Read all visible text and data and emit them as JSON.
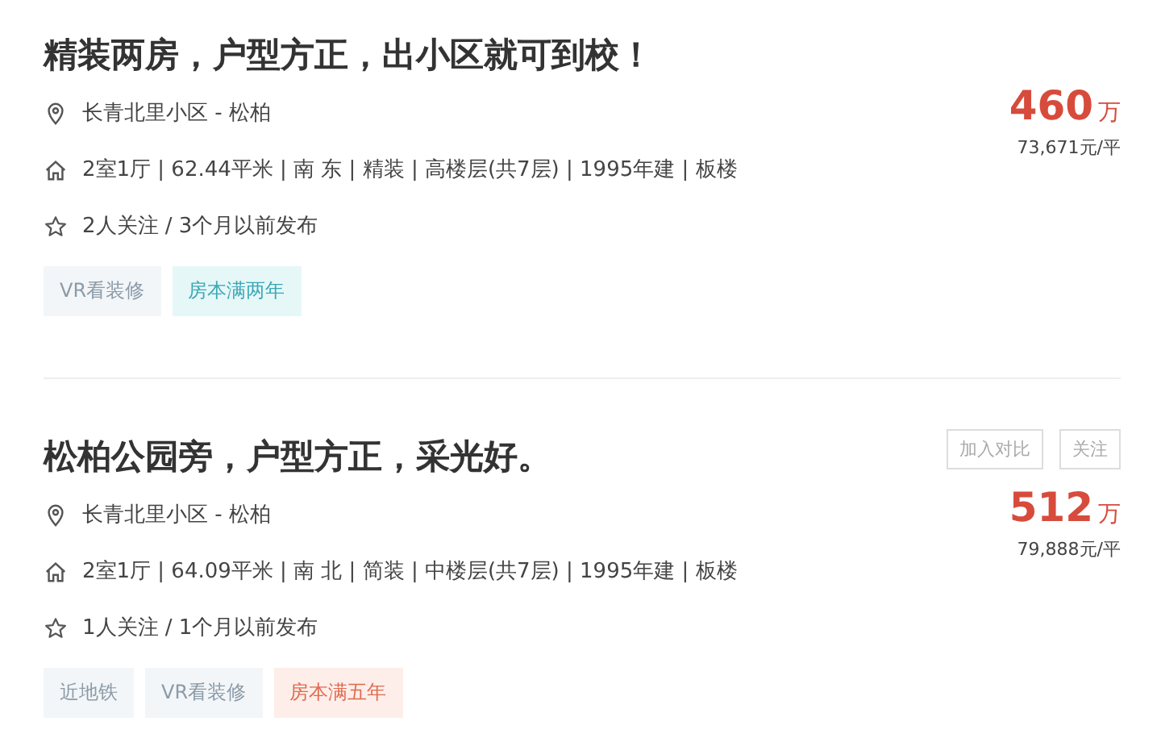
{
  "listings": [
    {
      "title": "精装两房，户型方正，出小区就可到校！",
      "location": "长青北里小区 - 松柏",
      "details": "2室1厅 | 62.44平米 | 南 东 | 精装 | 高楼层(共7层) | 1995年建 | 板楼",
      "follow": "2人关注 / 3个月以前发布",
      "price": "460",
      "price_unit": "万",
      "unit_price": "73,671元/平",
      "tags": [
        {
          "label": "VR看装修",
          "kind": "plain"
        },
        {
          "label": "房本满两年",
          "kind": "teal"
        }
      ]
    },
    {
      "title": "松柏公园旁，户型方正，采光好。",
      "location": "长青北里小区 - 松柏",
      "details": "2室1厅 | 64.09平米 | 南 北 | 简装 | 中楼层(共7层) | 1995年建 | 板楼",
      "follow": "1人关注 / 1个月以前发布",
      "price": "512",
      "price_unit": "万",
      "unit_price": "79,888元/平",
      "actions": [
        "加入对比",
        "关注"
      ],
      "tags": [
        {
          "label": "近地铁",
          "kind": "plain"
        },
        {
          "label": "VR看装修",
          "kind": "plain"
        },
        {
          "label": "房本满五年",
          "kind": "red"
        }
      ]
    }
  ]
}
